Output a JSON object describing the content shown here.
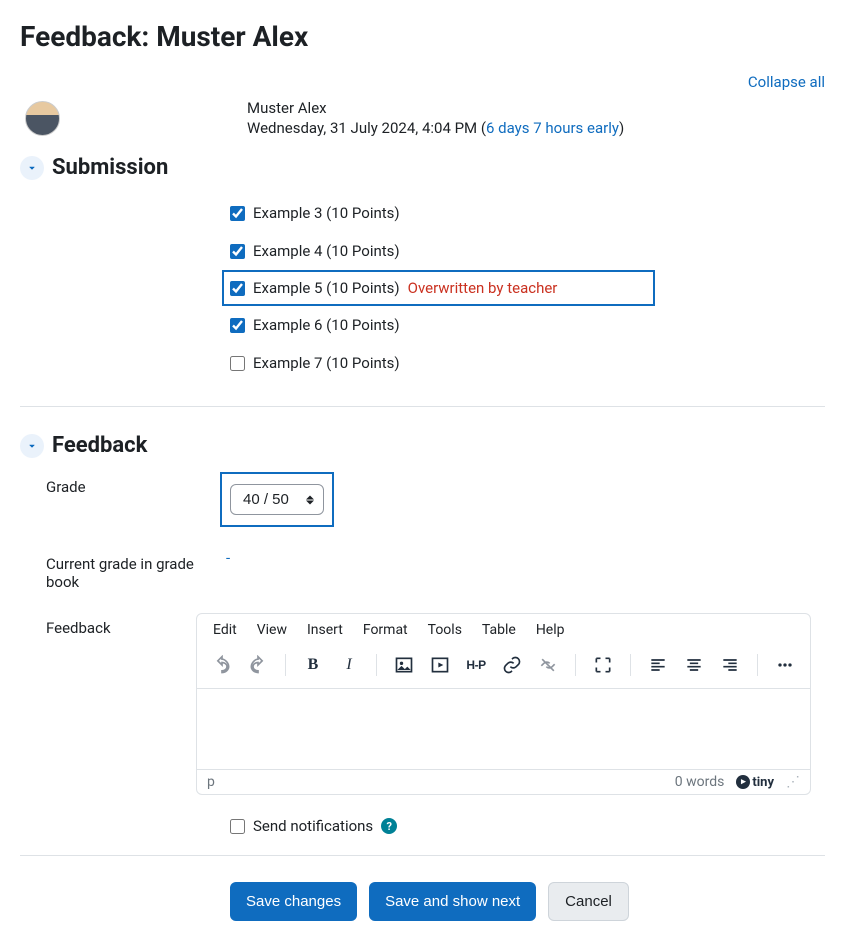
{
  "page_title": "Feedback: Muster Alex",
  "collapse_all_label": "Collapse all",
  "user": {
    "name": "Muster Alex",
    "timestamp": "Wednesday, 31 July 2024, 4:04 PM",
    "early_text": "6 days 7 hours early"
  },
  "sections": {
    "submission_title": "Submission",
    "feedback_title": "Feedback"
  },
  "submission_items": [
    {
      "label": "Example 3 (10 Points)",
      "checked": true,
      "overwritten": false,
      "highlighted": false
    },
    {
      "label": "Example 4 (10 Points)",
      "checked": true,
      "overwritten": false,
      "highlighted": false
    },
    {
      "label": "Example 5 (10 Points)",
      "checked": true,
      "overwritten": true,
      "highlighted": true
    },
    {
      "label": "Example 6 (10 Points)",
      "checked": true,
      "overwritten": false,
      "highlighted": false
    },
    {
      "label": "Example 7 (10 Points)",
      "checked": false,
      "overwritten": false,
      "highlighted": false
    }
  ],
  "overwritten_label": "Overwritten by teacher",
  "form": {
    "grade_label": "Grade",
    "grade_value": "40 / 50",
    "current_grade_label": "Current grade in grade book",
    "current_grade_value": "-",
    "feedback_label": "Feedback"
  },
  "editor": {
    "menus": [
      "Edit",
      "View",
      "Insert",
      "Format",
      "Tools",
      "Table",
      "Help"
    ],
    "status_path": "p",
    "word_count": "0 words",
    "brand": "tiny"
  },
  "notifications": {
    "label": "Send notifications",
    "checked": false
  },
  "buttons": {
    "save": "Save changes",
    "save_next": "Save and show next",
    "cancel": "Cancel"
  }
}
